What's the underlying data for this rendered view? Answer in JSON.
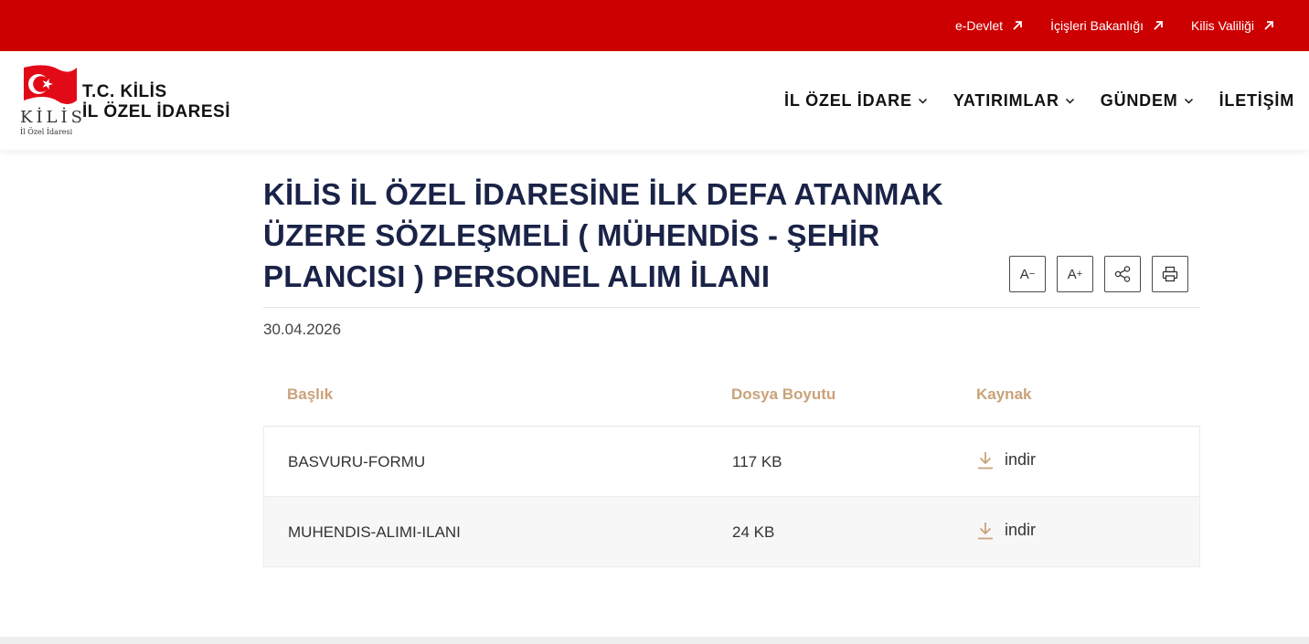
{
  "topbar": {
    "links": [
      {
        "label": "e-Devlet"
      },
      {
        "label": "İçişleri Bakanlığı"
      },
      {
        "label": "Kilis Valiliği"
      }
    ],
    "color": "#cc0000"
  },
  "logo": {
    "kilis": "KİLİS",
    "sub": "İl Özel İdaresi",
    "line1": "T.C. KİLİS",
    "line2": "İL ÖZEL İDARESİ"
  },
  "nav": {
    "items": [
      {
        "label": "İL ÖZEL İDARE",
        "has_dropdown": true
      },
      {
        "label": "YATIRIMLAR",
        "has_dropdown": true
      },
      {
        "label": "GÜNDEM",
        "has_dropdown": true
      },
      {
        "label": "İLETİŞİM",
        "has_dropdown": false
      }
    ]
  },
  "article": {
    "title": "KİLİS İL ÖZEL İDARESİNE İLK DEFA ATANMAK ÜZERE SÖZLEŞMELİ ( MÜHENDİS - ŞEHİR PLANCISI ) PERSONEL ALIM İLANI",
    "date": "30.04.2026",
    "tools": {
      "decrease": "A",
      "decrease_sup": "−",
      "increase": "A",
      "increase_sup": "+"
    }
  },
  "table": {
    "headers": [
      "Başlık",
      "Dosya Boyutu",
      "Kaynak"
    ],
    "rows": [
      {
        "title": "BASVURU-FORMU",
        "size": "117 KB",
        "source": "indir"
      },
      {
        "title": "MUHENDIS-ALIMI-ILANI",
        "size": "24 KB",
        "source": "indir"
      }
    ],
    "accent": "#c9a27a"
  }
}
